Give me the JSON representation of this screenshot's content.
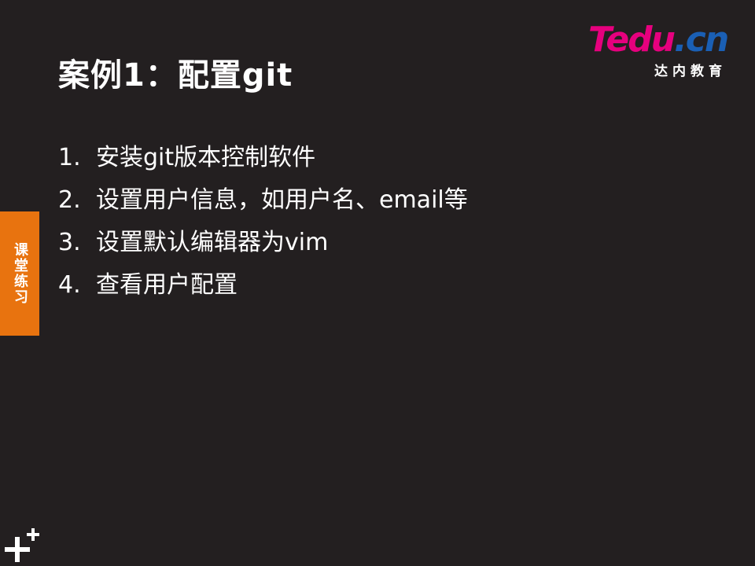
{
  "slide": {
    "title": "案例1：配置git",
    "logo": {
      "brand_pink": "Tedu",
      "brand_blue": ".cn",
      "subtitle": "达内教育",
      "pink_color": "#e6007e",
      "blue_color": "#1a5fb4"
    },
    "items": [
      {
        "num": "1.",
        "text": "安装git版本控制软件"
      },
      {
        "num": "2.",
        "text": "设置用户信息，如用户名、email等"
      },
      {
        "num": "3.",
        "text": "设置默认编辑器为vim"
      },
      {
        "num": "4.",
        "text": "查看用户配置"
      }
    ],
    "side_tab": {
      "label": "课堂练习",
      "color": "#e8730f"
    },
    "corner_icon": "plus-cross-icon",
    "background_color": "#231f20"
  }
}
